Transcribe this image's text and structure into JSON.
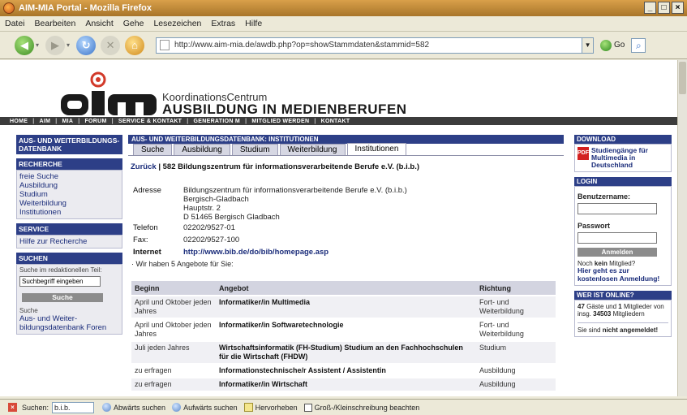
{
  "window": {
    "title": "AIM-MIA Portal - Mozilla Firefox"
  },
  "menubar": [
    "Datei",
    "Bearbeiten",
    "Ansicht",
    "Gehe",
    "Lesezeichen",
    "Extras",
    "Hilfe"
  ],
  "navbar": {
    "url": "http://www.aim-mia.de/awdb.php?op=showStammdaten&stammid=582",
    "go_label": "Go"
  },
  "banner": {
    "logo": "aim",
    "line1": "KoordinationsCentrum",
    "line2": "AUSBILDUNG IN MEDIENBERUFEN"
  },
  "topnav": [
    "HOME",
    "AIM",
    "MIA",
    "FORUM",
    "SERVICE & KONTAKT",
    "GENERATION M",
    "MITGLIED WERDEN",
    "KONTAKT"
  ],
  "left": {
    "sec1_title": "AUS- UND WEITERBILDUNGS-DATENBANK",
    "recherche_title": "RECHERCHE",
    "recherche_items": [
      "freie Suche",
      "Ausbildung",
      "Studium",
      "Weiterbildung",
      "Institutionen"
    ],
    "service_title": "SERVICE",
    "service_items": [
      "Hilfe zur Recherche"
    ],
    "suchen_title": "SUCHEN",
    "suchen_text": "Suche im redaktionellen Teil:",
    "search_placeholder": "Suchbegriff eingeben",
    "search_button": "Suche",
    "suche_label": "Suche",
    "suche_link": "Aus- und Weiter-bildungsdatenbank Foren"
  },
  "main": {
    "header": "AUS- UND WEITERBILDUNGSDATENBANK: INSTITUTIONEN",
    "tabs": [
      "Suche",
      "Ausbildung",
      "Studium",
      "Weiterbildung",
      "Institutionen"
    ],
    "back_label": "Zurück",
    "breadcrumb": " | 582 Bildungszentrum für informationsverarbeitende Berufe e.V. (b.i.b.)",
    "details": {
      "adresse_label": "Adresse",
      "address_lines": [
        "Bildungszentrum für informationsverarbeitende Berufe e.V. (b.i.b.)",
        "Bergisch-Gladbach",
        "Hauptstr. 2",
        "D 51465 Bergisch Gladbach"
      ],
      "telefon_label": "Telefon",
      "telefon": "02202/9527-01",
      "fax_label": "Fax:",
      "fax": "02202/9527-100",
      "internet_label": "Internet",
      "internet": "http://www.bib.de/do/bib/homepage.asp"
    },
    "offers_note": "· Wir haben 5 Angebote für Sie:",
    "table": {
      "headers": [
        "Beginn",
        "Angebot",
        "Richtung"
      ],
      "rows": [
        {
          "beginn": "April und Oktober jeden Jahres",
          "angebot": "Informatiker/in Multimedia",
          "richtung": "Fort- und Weiterbildung"
        },
        {
          "beginn": "April und Oktober jeden Jahres",
          "angebot": "Informatiker/in Softwaretechnologie",
          "richtung": "Fort- und Weiterbildung"
        },
        {
          "beginn": "Juli jeden Jahres",
          "angebot": "Wirtschaftsinformatik (FH-Studium) Studium an den Fachhochschulen für die Wirtschaft (FHDW)",
          "richtung": "Studium"
        },
        {
          "beginn": "zu erfragen",
          "angebot": "Informationstechnische/r Assistent / Assistentin",
          "richtung": "Ausbildung"
        },
        {
          "beginn": "zu erfragen",
          "angebot": "Informatiker/in Wirtschaft",
          "richtung": "Ausbildung"
        }
      ]
    }
  },
  "right": {
    "download_title": "DOWNLOAD",
    "download_link": "Studiengänge für Multimedia in Deutschland",
    "login_title": "LOGIN",
    "user_label": "Benutzername:",
    "pass_label": "Passwort",
    "login_button": "Anmelden",
    "noch_prefix": "Noch ",
    "noch_bold": "kein",
    "noch_suffix": " Mitglied?",
    "register_link": "Hier geht es zur kostenlosen Anmeldung!",
    "online_title": "WER IST ONLINE?",
    "guests": "47",
    "guests_text": " Gäste und ",
    "members": "1",
    "members_text": " Mitglieder von insg. ",
    "total": "34503",
    "total_text": " Mitgliedern",
    "status_prefix": "Sie sind ",
    "status_bold": "nicht angemeldet!"
  },
  "findbar": {
    "label": "Suchen:",
    "value": "b.i.b.",
    "prev": "Abwärts suchen",
    "next": "Aufwärts suchen",
    "highlight": "Hervorheben",
    "match_case": "Groß-/Kleinschreibung beachten"
  }
}
